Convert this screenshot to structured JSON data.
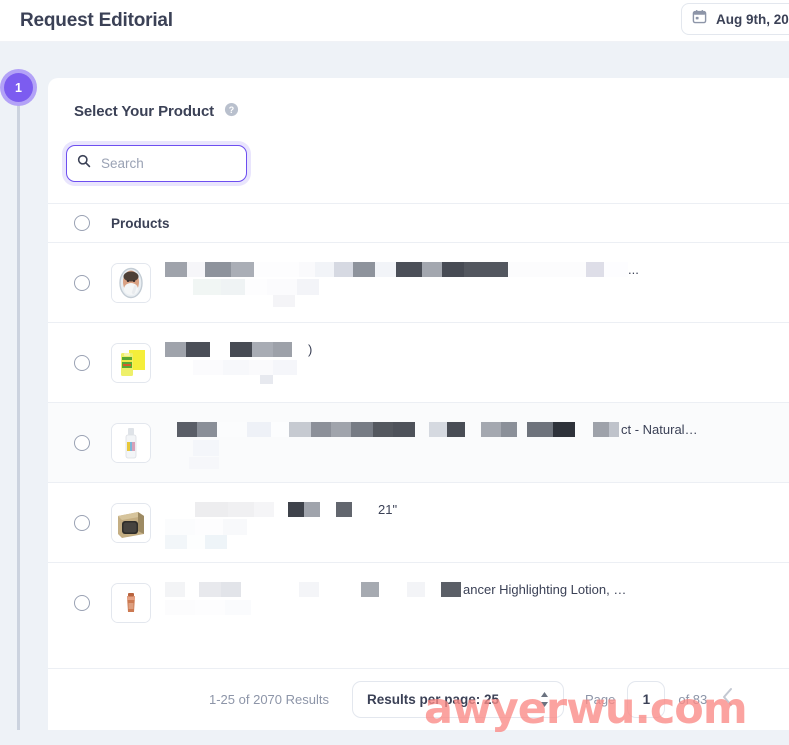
{
  "header": {
    "title": "Request Editorial",
    "date_icon": "calendar-icon",
    "date_value": "Aug 9th, 20"
  },
  "stepper": {
    "current_step": "1"
  },
  "card": {
    "title": "Select Your Product",
    "help_icon": "help-circle-icon"
  },
  "search": {
    "icon": "search-icon",
    "value": "",
    "placeholder": "Search"
  },
  "list": {
    "header_label": "Products",
    "header_radio": "radio-unselected",
    "rows": [
      {
        "radio": "radio-unselected",
        "thumbnail": "man-shaving-cream-thumbnail",
        "title_redacted": true,
        "tail_text": "",
        "tail_dots": "..."
      },
      {
        "radio": "radio-unselected",
        "thumbnail": "green-yellow-package-thumbnail",
        "title_redacted": true,
        "tail_text": ")",
        "tail_dots": ""
      },
      {
        "radio": "radio-unselected",
        "thumbnail": "white-spray-bottle-thumbnail",
        "title_redacted": true,
        "tail_text": "ct - Natural…",
        "tail_dots": ""
      },
      {
        "radio": "radio-unselected",
        "thumbnail": "tan-pet-crate-thumbnail",
        "title_redacted": true,
        "tail_text": "21\"",
        "tail_dots": ""
      },
      {
        "radio": "radio-unselected",
        "thumbnail": "copper-lotion-tube-thumbnail",
        "title_redacted": true,
        "tail_text": "ancer Highlighting Lotion, …",
        "tail_dots": ""
      }
    ]
  },
  "pagination": {
    "results_count": "1-25 of 2070 Results",
    "per_page_label": "Results per page: 25",
    "per_page_value": "25",
    "page_word": "Page",
    "page_value": "1",
    "of_pages": "of 83",
    "prev_icon": "chevron-left-icon",
    "stepper_icon": "spinner-updown-icon"
  },
  "watermark": {
    "text": "awyerwu.com",
    "color": "#fb8a86"
  },
  "colors": {
    "page_background": "#eef2f7",
    "card_background": "#ffffff",
    "accent_purple": "#7c5cf0",
    "accent_purple_ring": "#b3a2f7",
    "focus_border": "#6d4ef0",
    "text_primary": "#3b4156",
    "text_muted": "#8d95a8",
    "border": "#e3e7ee"
  }
}
